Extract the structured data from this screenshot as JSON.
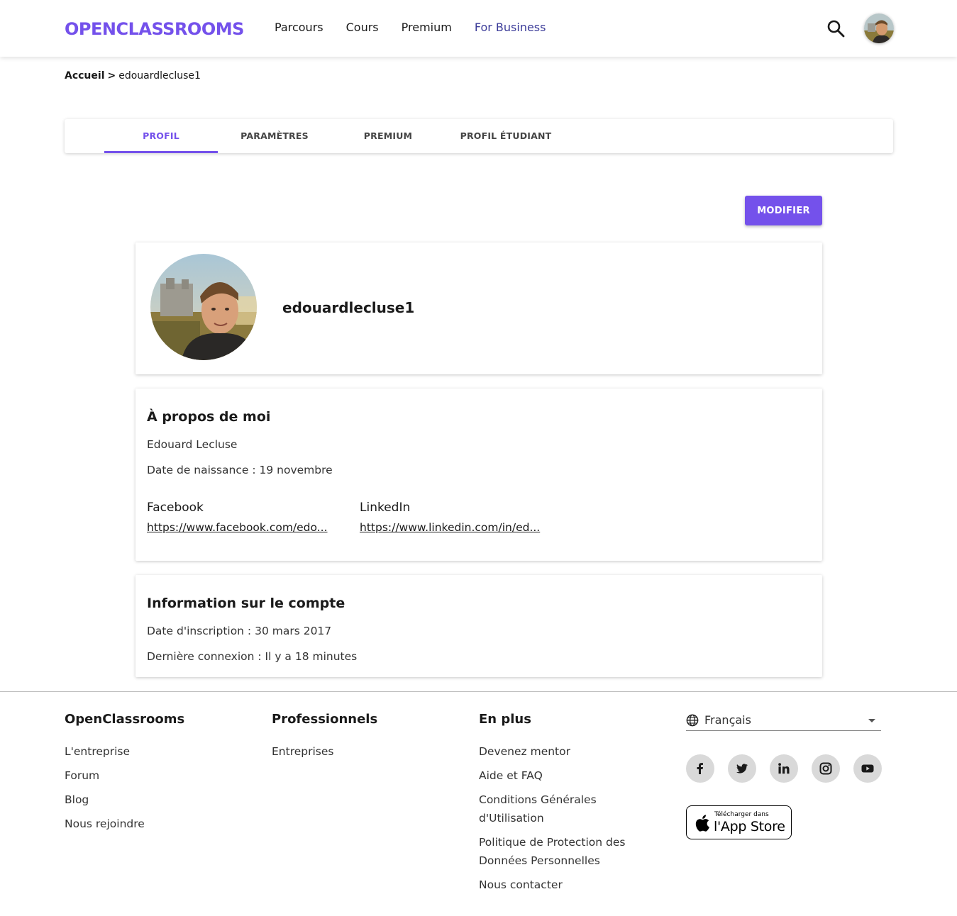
{
  "header": {
    "logo": "OPENCLASSROOMS",
    "nav": [
      "Parcours",
      "Cours",
      "Premium",
      "For Business"
    ]
  },
  "breadcrumb": {
    "home": "Accueil",
    "sep": ">",
    "current": "edouardlecluse1"
  },
  "tabs": [
    "PROFIL",
    "PARAMÈTRES",
    "PREMIUM",
    "PROFIL ÉTUDIANT"
  ],
  "actions": {
    "modify": "MODIFIER"
  },
  "profile": {
    "username": "edouardlecluse1"
  },
  "about": {
    "title": "À propos de moi",
    "name": "Edouard Lecluse",
    "birth": "Date de naissance : 19 novembre",
    "facebook_label": "Facebook",
    "facebook_url": "https://www.facebook.com/edo...",
    "linkedin_label": "LinkedIn",
    "linkedin_url": "https://www.linkedin.com/in/ed..."
  },
  "account": {
    "title": "Information sur le compte",
    "signup": "Date d'inscription : 30 mars 2017",
    "last_login": "Dernière connexion : Il y a 18 minutes"
  },
  "footer": {
    "col1": {
      "title": "OpenClassrooms",
      "links": [
        "L'entreprise",
        "Forum",
        "Blog",
        "Nous rejoindre"
      ]
    },
    "col2": {
      "title": "Professionnels",
      "links": [
        "Entreprises"
      ]
    },
    "col3": {
      "title": "En plus",
      "links": [
        "Devenez mentor",
        "Aide et FAQ",
        "Conditions Générales d'Utilisation",
        "Politique de Protection des Données Personnelles",
        "Nous contacter"
      ]
    },
    "language": "Français",
    "appstore_small": "Télécharger dans",
    "appstore_big": "l'App Store"
  },
  "colors": {
    "accent": "#7451eb",
    "business": "#3c3c99"
  }
}
